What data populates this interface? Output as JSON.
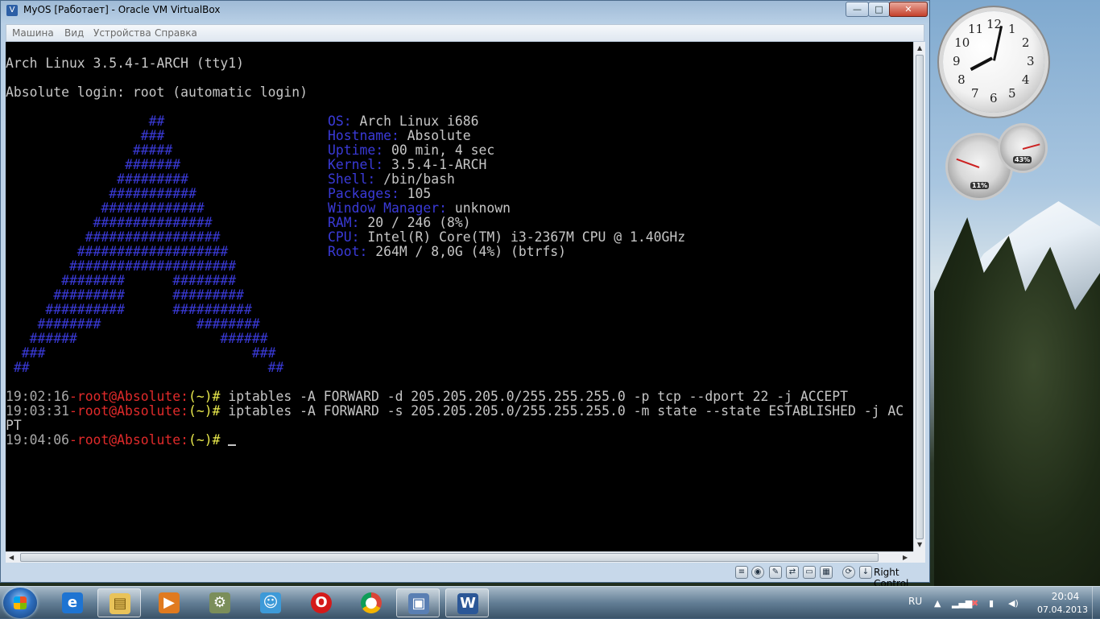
{
  "window": {
    "title": "MyOS [Работает] - Oracle VM VirtualBox",
    "btn_min": "—",
    "btn_max": "□",
    "btn_close": "✕"
  },
  "menu": [
    "Машина",
    "Вид",
    "Устройства",
    "Справка"
  ],
  "console": {
    "line1": "Arch Linux 3.5.4-1-ARCH (tty1)",
    "line2": "Absolute login: root (automatic login)",
    "ascii_logo": [
      "                  ##",
      "                 ###",
      "                #####",
      "               #######",
      "              #########",
      "             ###########",
      "            #############",
      "           ###############",
      "          #################",
      "         ###################",
      "        #####################",
      "       ########      ########",
      "      #########      #########",
      "     ##########      ##########",
      "    ########            ########",
      "   ######                  ######",
      "  ###                          ###",
      " ##                              ##"
    ],
    "info": [
      {
        "key": "OS:",
        "value": "Arch Linux i686"
      },
      {
        "key": "Hostname:",
        "value": "Absolute"
      },
      {
        "key": "Uptime:",
        "value": "00 min, 4 sec"
      },
      {
        "key": "Kernel:",
        "value": "3.5.4-1-ARCH"
      },
      {
        "key": "Shell:",
        "value": "/bin/bash"
      },
      {
        "key": "Packages:",
        "value": "105"
      },
      {
        "key": "Window Manager:",
        "value": "unknown"
      },
      {
        "key": "RAM:",
        "value": "20 / 246 (8%)"
      },
      {
        "key": "CPU:",
        "value": "Intel(R) Core(TM) i3-2367M CPU @ 1.40GHz"
      },
      {
        "key": "Root:",
        "value": "264M / 8,0G (4%) (btrfs)"
      }
    ],
    "prompts": [
      {
        "time": "19:02:16",
        "user": "-root@Absolute:",
        "dir": "(~)#",
        "cmd": " iptables -A FORWARD -d 205.205.205.0/255.255.255.0 -p tcp --dport 22 -j ACCEPT"
      },
      {
        "time": "19:03:31",
        "user": "-root@Absolute:",
        "dir": "(~)#",
        "cmd": " iptables -A FORWARD -s 205.205.205.0/255.255.255.0 -m state --state ESTABLISHED -j AC"
      },
      {
        "time": "19:04:06",
        "user": "-root@Absolute:",
        "dir": "(~)#",
        "cmd": " "
      }
    ],
    "wrap": "PT"
  },
  "statusbar": {
    "host_key": "Right Control",
    "icons": [
      "hdd-icon",
      "cd-icon",
      "usb-icon",
      "network-icon",
      "shared-folder-icon",
      "display-icon",
      "capture-icon",
      "arrow-icon"
    ]
  },
  "gadgets": {
    "clock_numbers": [
      "12",
      "1",
      "2",
      "3",
      "4",
      "5",
      "6",
      "7",
      "8",
      "9",
      "10",
      "11"
    ],
    "cpu_percent": "11%",
    "ram_percent": "43%"
  },
  "taskbar": {
    "apps": [
      "internet-explorer",
      "explorer",
      "media-player",
      "program-icon",
      "messenger",
      "opera",
      "chrome",
      "virtualbox",
      "word"
    ],
    "lang": "RU",
    "time": "20:04",
    "date": "07.04.2013"
  },
  "colors": {
    "console_bg": "#000000",
    "logo_blue": "#3a3ad8",
    "prompt_red": "#e02a2a",
    "prompt_yellow": "#e8e84c"
  }
}
